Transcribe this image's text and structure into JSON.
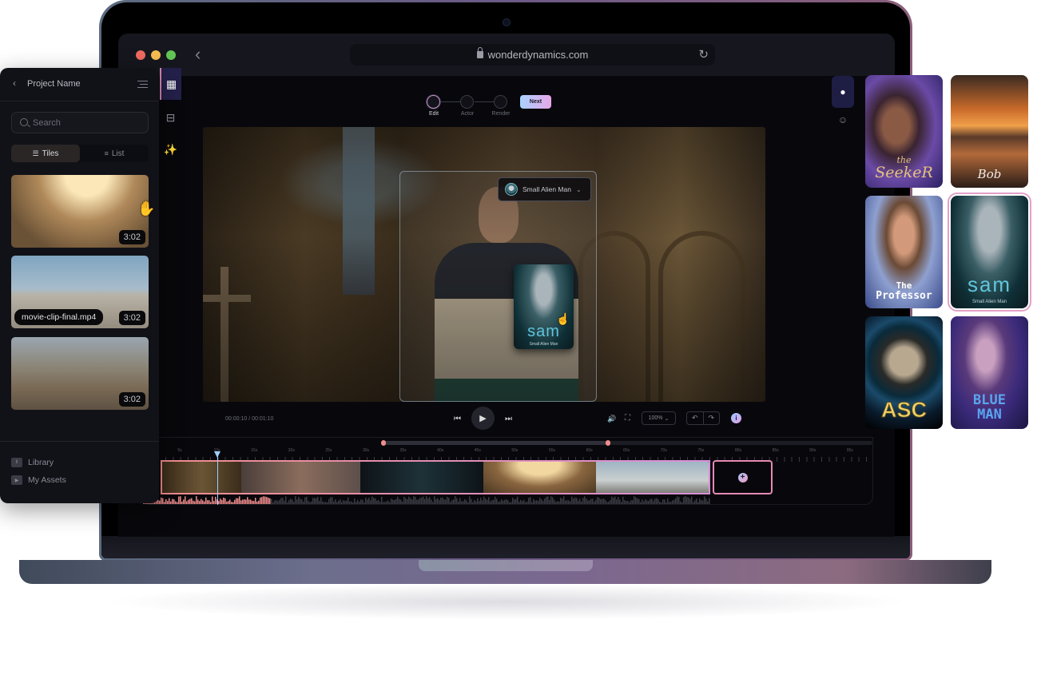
{
  "browser": {
    "url": "wonderdynamics.com",
    "traffic_lights": [
      "#ee6a5f",
      "#f5bd4f",
      "#61c454"
    ]
  },
  "panel": {
    "title": "Project Name",
    "search_placeholder": "Search",
    "view_options": [
      {
        "label": "Tiles",
        "icon": "tiles-icon",
        "active": true
      },
      {
        "label": "List",
        "icon": "list-icon",
        "active": false
      }
    ],
    "clips": [
      {
        "name": "",
        "duration": "3:02"
      },
      {
        "name": "movie-clip-final.mp4",
        "duration": "3:02"
      },
      {
        "name": "",
        "duration": "3:02"
      }
    ],
    "nav": [
      {
        "label": "Library",
        "icon": "library-icon"
      },
      {
        "label": "My Assets",
        "icon": "play-square-icon"
      }
    ]
  },
  "stepper": {
    "steps": [
      {
        "label": "Edit",
        "active": true
      },
      {
        "label": "Actor",
        "active": false
      },
      {
        "label": "Render",
        "active": false
      }
    ],
    "next_label": "Next"
  },
  "player": {
    "character_select": "Small Alien Man",
    "drag_card_title": "sam",
    "drag_card_subtitle": "Small Alien Man",
    "timecode_current": "00:00:10",
    "timecode_total": "00:01:10",
    "timecode_sep": "/",
    "zoom_level": "100%"
  },
  "timeline": {
    "tick_labels": [
      "5s",
      "10s",
      "15s",
      "20s",
      "25s",
      "30s",
      "35s",
      "40s",
      "45s",
      "50s",
      "55s",
      "60s",
      "65s",
      "70s",
      "75s",
      "80s",
      "85s",
      "90s",
      "95s"
    ],
    "playhead_seconds": 10,
    "clip_count": 6
  },
  "characters": [
    {
      "title_line1": "the",
      "title_line2": "SeekeR",
      "selected": false
    },
    {
      "title_line1": "",
      "title_line2": "Bob",
      "selected": false
    },
    {
      "title_line1": "The",
      "title_line2": "Professor",
      "selected": false
    },
    {
      "title_line1": "sam",
      "title_line2": "Small Alien Man",
      "selected": true
    },
    {
      "title_line1": "",
      "title_line2": "ASC",
      "selected": false
    },
    {
      "title_line1": "BLUE",
      "title_line2": "MAN",
      "selected": false
    }
  ],
  "colors": {
    "accent_pink": "#f08d8d",
    "accent_purple": "#d790d8",
    "playhead": "#9ccfff",
    "active_rail": "#23214a"
  }
}
